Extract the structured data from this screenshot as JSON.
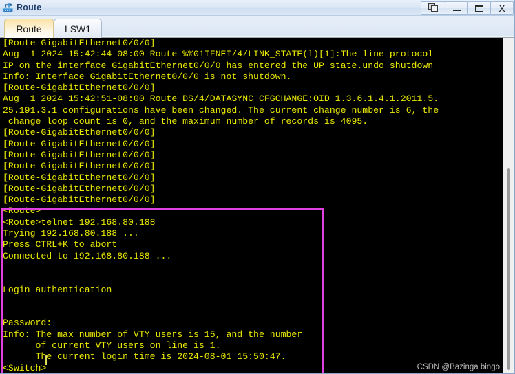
{
  "window": {
    "title": "Route",
    "icon": "router-icon",
    "controls": [
      {
        "name": "restore-button",
        "glyph": "restore-icon",
        "label": "Restore"
      },
      {
        "name": "minimize-button",
        "glyph": "minimize-icon",
        "label": "Minimize"
      },
      {
        "name": "maximize-button",
        "glyph": "maximize-icon",
        "label": "Maximize"
      },
      {
        "name": "close-button",
        "glyph": "close-icon",
        "label": "X"
      }
    ]
  },
  "tabs": [
    {
      "label": "Route",
      "active": true
    },
    {
      "label": "LSW1",
      "active": false
    }
  ],
  "terminal": {
    "foreground_color": "#e8e800",
    "background_color": "#000000",
    "lines": [
      "[Route-GigabitEthernet0/0/0]",
      "Aug  1 2024 15:42:44-08:00 Route %%01IFNET/4/LINK_STATE(l)[1]:The line protocol",
      "IP on the interface GigabitEthernet0/0/0 has entered the UP state.undo shutdown",
      "Info: Interface GigabitEthernet0/0/0 is not shutdown.",
      "[Route-GigabitEthernet0/0/0]",
      "Aug  1 2024 15:42:51-08:00 Route DS/4/DATASYNC_CFGCHANGE:OID 1.3.6.1.4.1.2011.5.",
      "25.191.3.1 configurations have been changed. The current change number is 6, the",
      " change loop count is 0, and the maximum number of records is 4095.",
      "[Route-GigabitEthernet0/0/0]",
      "[Route-GigabitEthernet0/0/0]",
      "[Route-GigabitEthernet0/0/0]",
      "[Route-GigabitEthernet0/0/0]",
      "[Route-GigabitEthernet0/0/0]",
      "[Route-GigabitEthernet0/0/0]",
      "[Route-GigabitEthernet0/0/0]",
      "<Route>",
      "<Route>telnet 192.168.80.188",
      "Trying 192.168.80.188 ...",
      "Press CTRL+K to abort",
      "Connected to 192.168.80.188 ...",
      "",
      "",
      "Login authentication",
      "",
      "",
      "Password:",
      "Info: The max number of VTY users is 15, and the number",
      "      of current VTY users on line is 1.",
      "      The current login time is 2024-08-01 15:50:47.",
      "<Switch>"
    ]
  },
  "annotation": {
    "color": "#e040e0",
    "shape": "rectangle"
  },
  "watermark": {
    "text": "CSDN @Bazinga bingo"
  },
  "scrollbar": {
    "orientation": "vertical"
  }
}
